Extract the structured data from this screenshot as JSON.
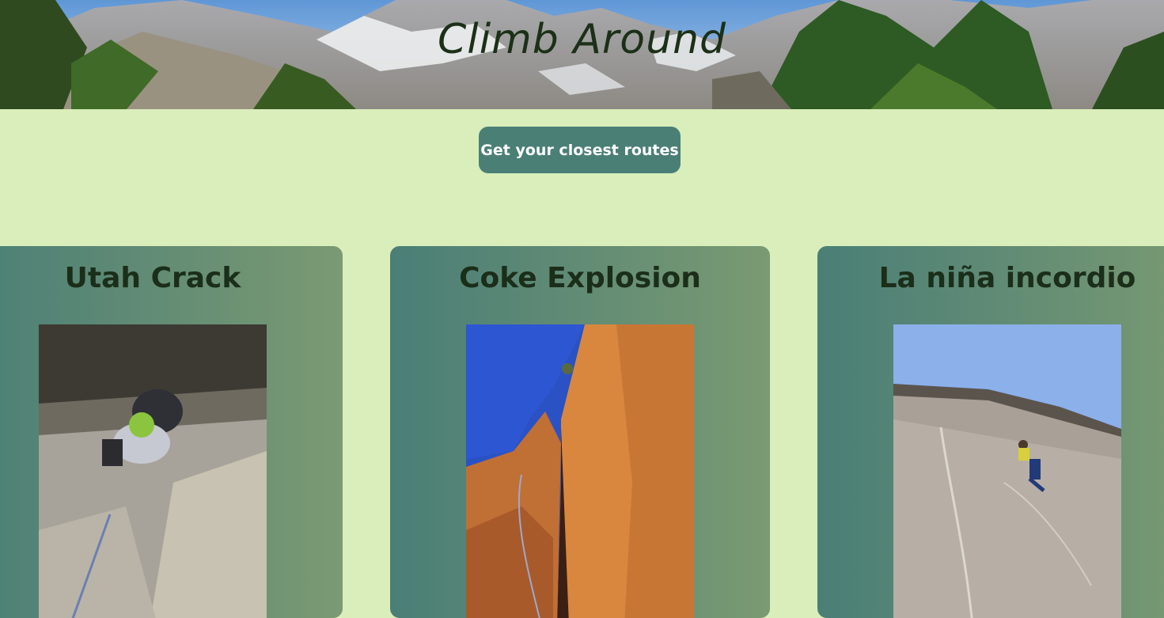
{
  "header": {
    "title": "Climb Around",
    "banner_alt": "mountain-landscape-banner"
  },
  "actions": {
    "closest_routes_label": "Get your closest routes"
  },
  "routes": [
    {
      "name": "Utah Crack",
      "photo": "climber-on-gray-slab-photo"
    },
    {
      "name": "Coke Explosion",
      "photo": "orange-sandstone-crack-photo"
    },
    {
      "name": "La niña incordio",
      "photo": "granite-slab-climber-photo"
    }
  ],
  "colors": {
    "page_background": "#d9eebb",
    "button": "#4a7f76",
    "card_left": "#4a7f76",
    "card_right": "#7a9a72",
    "title_text": "#1c3018"
  }
}
